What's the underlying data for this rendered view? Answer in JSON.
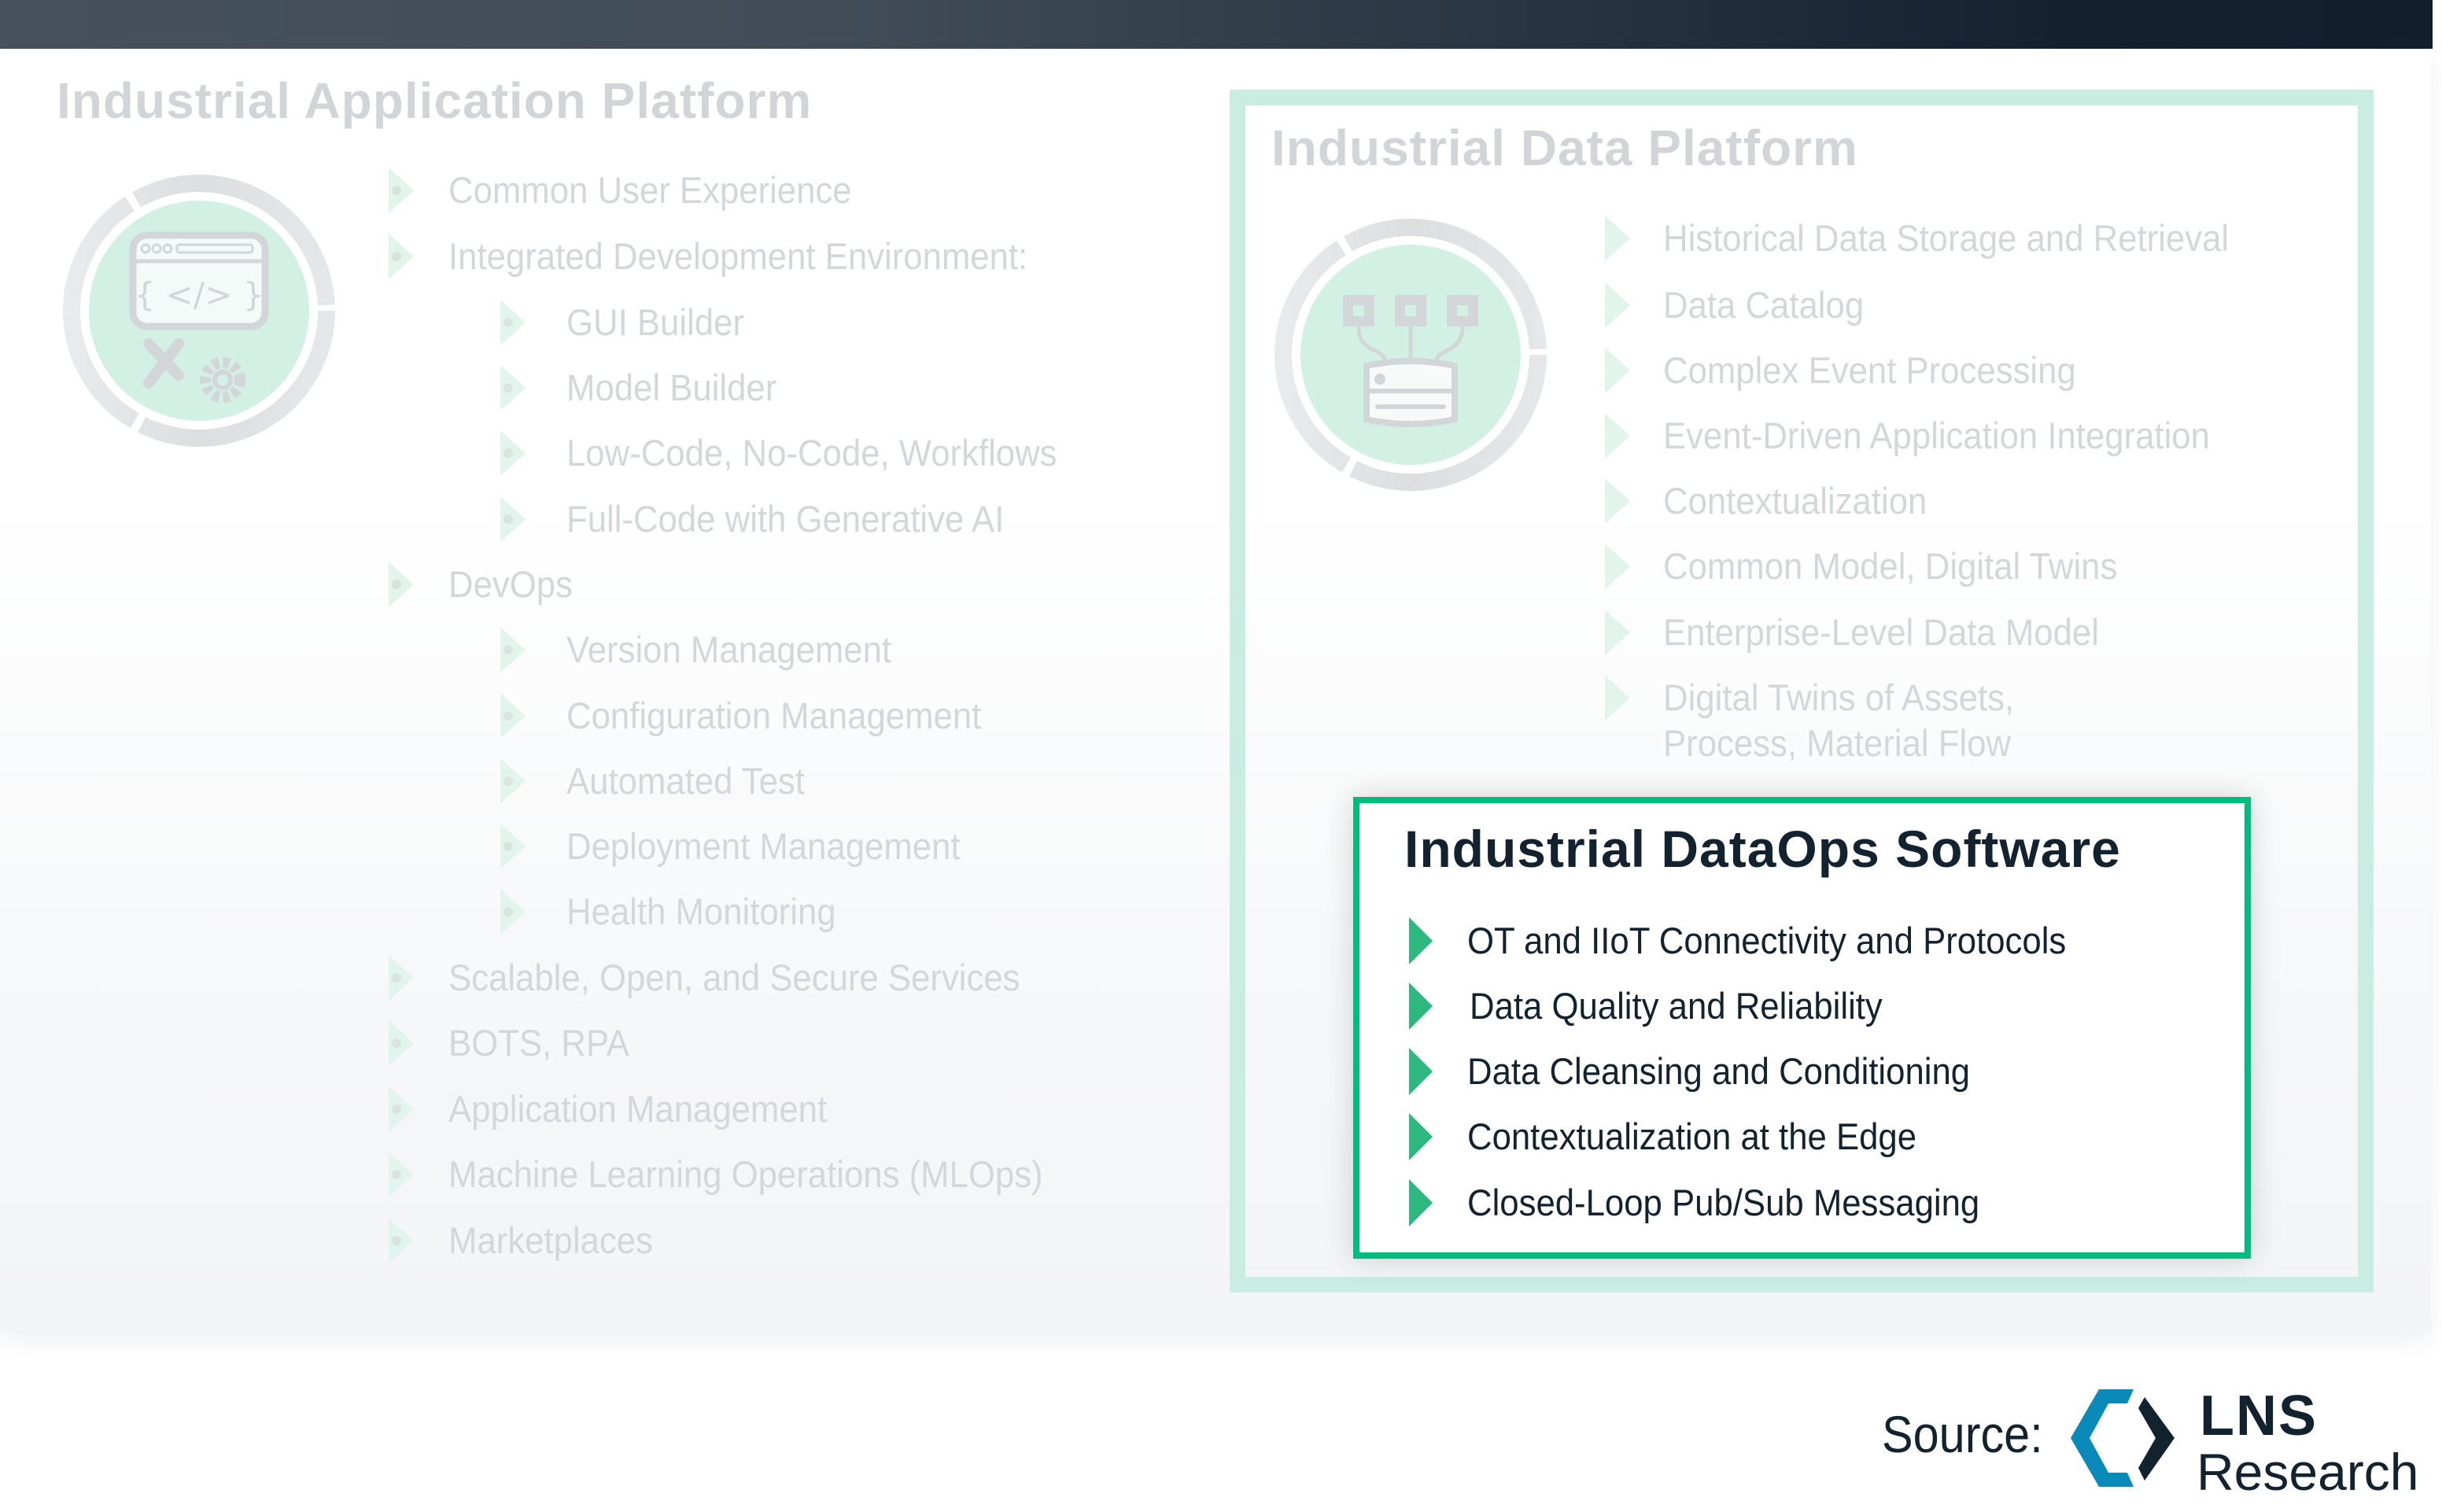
{
  "colors": {
    "faded_text": "#d4d7da",
    "faded_bullet": "#e2f5ed",
    "platform_border": "#c9eee1",
    "dataops_border": "#00bd7e",
    "dataops_bullet": "#2cb87f",
    "dark_text": "#13222f",
    "logo_blue": "#0a8ab8"
  },
  "app_platform": {
    "title": "Industrial Application Platform",
    "icon": "code-window-tools-icon",
    "items": [
      {
        "label": "Common User Experience",
        "level": 1
      },
      {
        "label": "Integrated Development Environment:",
        "level": 1
      },
      {
        "label": "GUI Builder",
        "level": 2
      },
      {
        "label": "Model Builder",
        "level": 2
      },
      {
        "label": "Low-Code, No-Code, Workflows",
        "level": 2
      },
      {
        "label": "Full-Code with Generative AI",
        "level": 2
      },
      {
        "label": "DevOps",
        "level": 1
      },
      {
        "label": "Version Management",
        "level": 2
      },
      {
        "label": "Configuration Management",
        "level": 2
      },
      {
        "label": "Automated Test",
        "level": 2
      },
      {
        "label": "Deployment Management",
        "level": 2
      },
      {
        "label": "Health Monitoring",
        "level": 2
      },
      {
        "label": "Scalable, Open, and Secure Services",
        "level": 1
      },
      {
        "label": "BOTS, RPA",
        "level": 1
      },
      {
        "label": "Application Management",
        "level": 1
      },
      {
        "label": "Machine Learning Operations (MLOps)",
        "level": 1
      },
      {
        "label": "Marketplaces",
        "level": 1
      }
    ]
  },
  "data_platform": {
    "title": "Industrial Data Platform",
    "icon": "database-network-icon",
    "items": [
      "Historical Data Storage and Retrieval",
      "Data Catalog",
      "Complex Event Processing",
      "Event-Driven Application Integration",
      "Contextualization",
      "Common Model, Digital Twins",
      "Enterprise-Level Data Model",
      "Digital Twins of Assets,",
      "Process, Material Flow"
    ]
  },
  "dataops": {
    "title": "Industrial DataOps Software",
    "items": [
      "OT and IIoT Connectivity and Protocols",
      "Data Quality and Reliability",
      "Data Cleansing and Conditioning",
      "Contextualization at the Edge",
      "Closed-Loop Pub/Sub Messaging"
    ]
  },
  "source": {
    "label": "Source:",
    "brand_name": "LNS",
    "brand_sub": "Research"
  }
}
